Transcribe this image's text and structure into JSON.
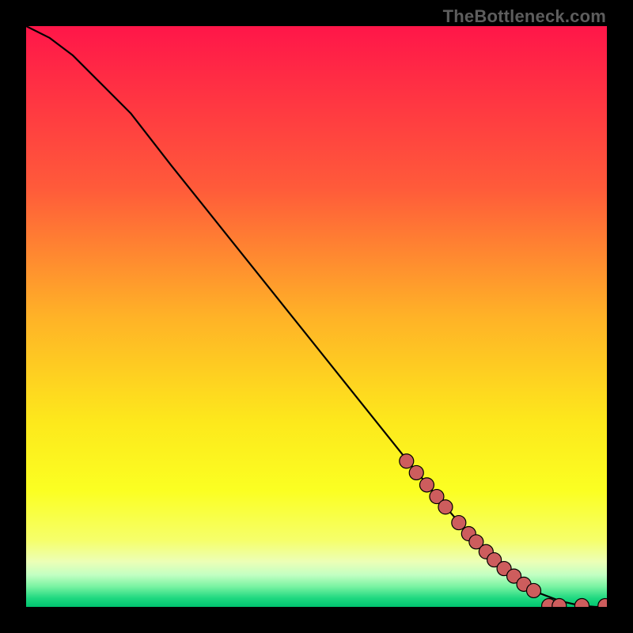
{
  "watermark": "TheBottleneck.com",
  "colors": {
    "background": "#000000",
    "curve": "#000000",
    "point_fill": "#cd5d5d",
    "point_stroke": "#000000",
    "gradient_stops": [
      {
        "offset": 0.0,
        "color": "#ff1649"
      },
      {
        "offset": 0.28,
        "color": "#ff5b3a"
      },
      {
        "offset": 0.5,
        "color": "#ffb227"
      },
      {
        "offset": 0.68,
        "color": "#fde81c"
      },
      {
        "offset": 0.8,
        "color": "#fbff22"
      },
      {
        "offset": 0.885,
        "color": "#f6ff6a"
      },
      {
        "offset": 0.922,
        "color": "#ecffb6"
      },
      {
        "offset": 0.945,
        "color": "#c2ffc2"
      },
      {
        "offset": 0.965,
        "color": "#79f3a2"
      },
      {
        "offset": 0.985,
        "color": "#1fd880"
      },
      {
        "offset": 1.0,
        "color": "#00c46f"
      }
    ]
  },
  "chart_data": {
    "type": "line",
    "title": "",
    "xlabel": "",
    "ylabel": "",
    "xlim": [
      0,
      1
    ],
    "ylim": [
      0,
      1
    ],
    "series": [
      {
        "name": "curve",
        "x": [
          0.0,
          0.04,
          0.08,
          0.12,
          0.18,
          0.25,
          0.35,
          0.45,
          0.55,
          0.65,
          0.72,
          0.78,
          0.83,
          0.88,
          0.92,
          0.955,
          0.98,
          1.0
        ],
        "y": [
          1.0,
          0.98,
          0.95,
          0.91,
          0.85,
          0.76,
          0.635,
          0.51,
          0.385,
          0.26,
          0.175,
          0.105,
          0.06,
          0.025,
          0.01,
          0.002,
          0.0,
          0.0
        ]
      }
    ],
    "points_on_curve": [
      {
        "x": 0.655,
        "y": 0.251
      },
      {
        "x": 0.672,
        "y": 0.231
      },
      {
        "x": 0.69,
        "y": 0.21
      },
      {
        "x": 0.707,
        "y": 0.19
      },
      {
        "x": 0.722,
        "y": 0.172
      },
      {
        "x": 0.745,
        "y": 0.145
      },
      {
        "x": 0.762,
        "y": 0.126
      },
      {
        "x": 0.775,
        "y": 0.112
      },
      {
        "x": 0.792,
        "y": 0.095
      },
      {
        "x": 0.806,
        "y": 0.081
      },
      {
        "x": 0.823,
        "y": 0.066
      },
      {
        "x": 0.84,
        "y": 0.053
      },
      {
        "x": 0.857,
        "y": 0.039
      },
      {
        "x": 0.874,
        "y": 0.028
      },
      {
        "x": 0.9,
        "y": 0.002
      },
      {
        "x": 0.918,
        "y": 0.002
      },
      {
        "x": 0.957,
        "y": 0.002
      },
      {
        "x": 0.997,
        "y": 0.002
      }
    ]
  }
}
